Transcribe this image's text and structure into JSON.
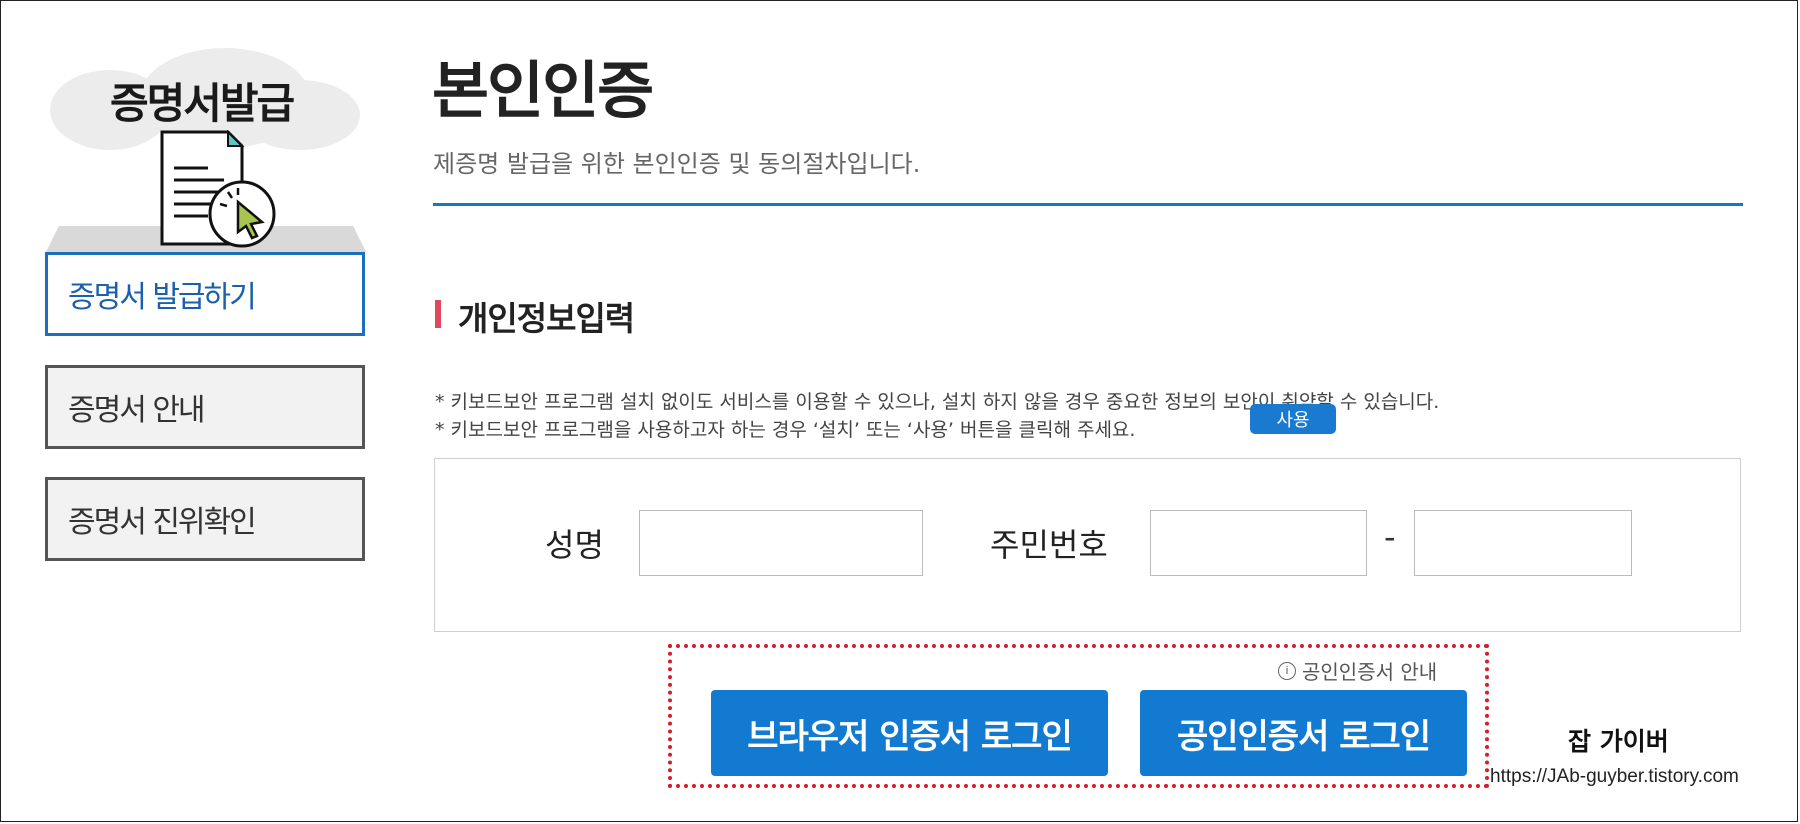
{
  "sidebar": {
    "title": "증명서발급",
    "items": [
      {
        "label": "증명서 발급하기",
        "active": true
      },
      {
        "label": "증명서 안내",
        "active": false
      },
      {
        "label": "증명서 진위확인",
        "active": false
      }
    ]
  },
  "header": {
    "title": "본인인증",
    "subtitle": "제증명 발급을 위한 본인인증 및 동의절차입니다."
  },
  "section": {
    "title": "개인정보입력",
    "note1": "* 키보드보안 프로그램 설치 없이도 서비스를 이용할 수 있으나, 설치 하지 않을 경우 중요한 정보의 보안이 취약할 수 있습니다.",
    "note2": "* 키보드보안 프로그램을 사용하고자 하는 경우 ‘설치’ 또는 ‘사용’ 버튼을 클릭해 주세요.",
    "use_button": "사용"
  },
  "form": {
    "name_label": "성명",
    "name_value": "",
    "ssn_label": "주민번호",
    "ssn_front_value": "",
    "ssn_back_value": "",
    "ssn_separator": "-"
  },
  "login": {
    "cert_info_link": "공인인증서 안내",
    "browser_cert_button": "브라우저 인증서 로그인",
    "public_cert_button": "공인인증서 로그인"
  },
  "watermark": {
    "title": "잡 가이버",
    "url": "https://JAb-guyber.tistory.com"
  },
  "colors": {
    "accent_blue": "#137ad2",
    "title_line": "#1677c4",
    "section_marker": "#e04860",
    "highlight_dotted": "#d21f2a"
  },
  "icons": {
    "sidebar_illustration": "document-cursor-icon",
    "cert_info": "info-circle-icon"
  }
}
